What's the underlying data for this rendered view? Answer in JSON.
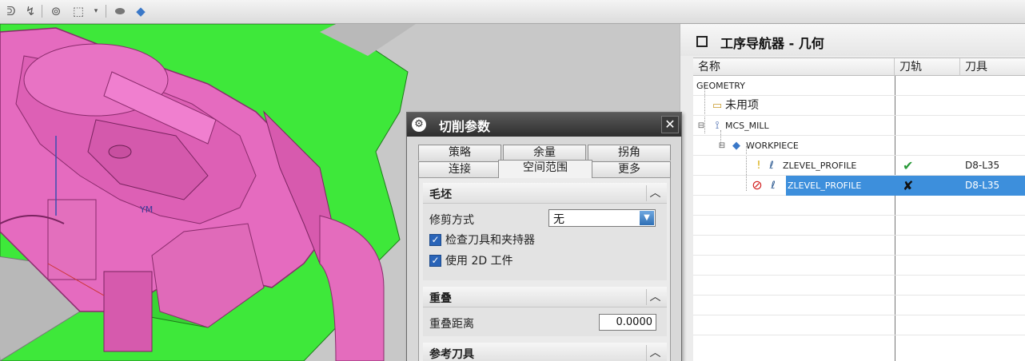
{
  "toolbar": {
    "icons": [
      "tool-icon",
      "sweep-icon",
      "target-icon",
      "selection-box-icon",
      "dropdown-icon",
      "circle-shape-icon",
      "cube-icon"
    ]
  },
  "viewport": {
    "colors": {
      "part": "#e56bbf",
      "base": "#3ee83a",
      "background": "#c8c8c8"
    },
    "labels": {
      "y_axis": "YM"
    }
  },
  "navigator": {
    "title": "工序导航器 - 几何",
    "columns": [
      "名称",
      "刀轨",
      "刀具"
    ],
    "rows": [
      {
        "name": "GEOMETRY",
        "path": "",
        "tool": "",
        "level": 0,
        "icon": ""
      },
      {
        "name": "未用项",
        "path": "",
        "tool": "",
        "level": 1,
        "icon": "folder-icon"
      },
      {
        "name": "MCS_MILL",
        "path": "",
        "tool": "",
        "level": 1,
        "icon": "coordinate-system-icon"
      },
      {
        "name": "WORKPIECE",
        "path": "",
        "tool": "",
        "level": 2,
        "icon": "workpiece-icon"
      },
      {
        "name": "ZLEVEL_PROFILE",
        "path": "✔",
        "tool": "D8-L35",
        "level": 3,
        "icon": "operation-icon"
      },
      {
        "name": "ZLEVEL_PROFILE",
        "path": "✘",
        "tool": "D8-L35",
        "level": 3,
        "icon": "operation-icon"
      }
    ],
    "selected_index": 5,
    "colors": {
      "selection": "#3d8fdc",
      "check": "#2a9a3a"
    }
  },
  "dialog": {
    "title": "切削参数",
    "tabs_row1": [
      "策略",
      "余量",
      "拐角"
    ],
    "tabs_row2": [
      "连接",
      "空间范围",
      "更多"
    ],
    "active_tab": "空间范围",
    "groups": {
      "blank": {
        "title": "毛坯",
        "trim_label": "修剪方式",
        "trim_value": "无",
        "check_tool_label": "检查刀具和夹持器",
        "check_tool_checked": true,
        "use_2d_label": "使用 2D 工件",
        "use_2d_checked": true
      },
      "overlap": {
        "title": "重叠",
        "distance_label": "重叠距离",
        "distance_value": "0.0000"
      },
      "ref_tool": {
        "title": "参考刀具"
      }
    },
    "colors": {
      "annotation_arrow": "#e02020"
    }
  }
}
